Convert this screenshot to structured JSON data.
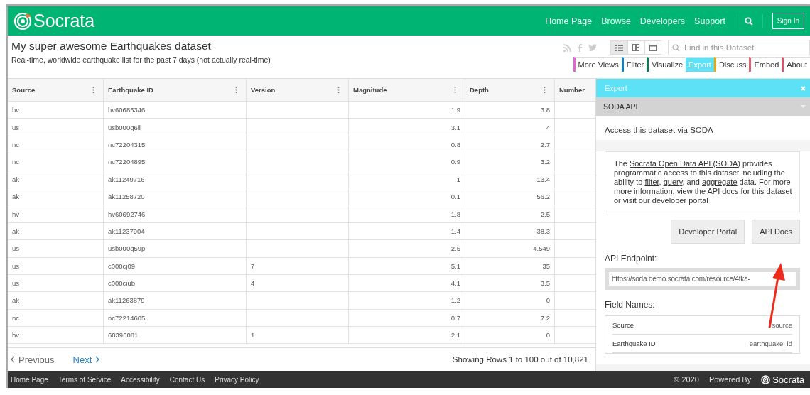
{
  "header": {
    "logo": "Socrata",
    "nav": [
      "Home Page",
      "Browse",
      "Developers",
      "Support"
    ],
    "sign_in": "Sign In"
  },
  "dataset": {
    "title": "My super awesome Earthquakes dataset",
    "description": "Real-time, worldwide earthquake list for the past 7 days (not actually real-time)"
  },
  "view_buttons": [
    {
      "selected": true
    },
    {
      "selected": false
    },
    {
      "selected": false
    }
  ],
  "search": {
    "placeholder": "Find in this Dataset"
  },
  "tabs": [
    {
      "label": "More Views",
      "color": "#e066d6",
      "selected": false
    },
    {
      "label": "Filter",
      "color": "#1a7fc1",
      "selected": false
    },
    {
      "label": "Visualize",
      "color": "#0a7a4f",
      "selected": false
    },
    {
      "label": "Export",
      "selected": true
    },
    {
      "label": "Discuss",
      "color": "#f0a500",
      "selected": false
    },
    {
      "label": "Embed",
      "color": "#e06070",
      "selected": false
    },
    {
      "label": "About",
      "color": "#d9536b",
      "selected": false
    }
  ],
  "table": {
    "columns": [
      "Source",
      "Earthquake ID",
      "Version",
      "Magnitude",
      "Depth",
      "Number"
    ],
    "rows": [
      [
        "hv",
        "hv60685346",
        "",
        "1.9",
        "3.8"
      ],
      [
        "us",
        "usb000q6il",
        "",
        "3.1",
        "4"
      ],
      [
        "nc",
        "nc72204315",
        "",
        "0.8",
        "2.7"
      ],
      [
        "nc",
        "nc72204895",
        "",
        "0.9",
        "3.2"
      ],
      [
        "ak",
        "ak11249716",
        "",
        "1",
        "13.4"
      ],
      [
        "ak",
        "ak11258720",
        "",
        "0.1",
        "56.2"
      ],
      [
        "hv",
        "hv60692746",
        "",
        "1.8",
        "2.5"
      ],
      [
        "ak",
        "ak11237904",
        "",
        "1.4",
        "38.3"
      ],
      [
        "us",
        "usb000q59p",
        "",
        "2.5",
        "4.549"
      ],
      [
        "us",
        "c000cj09",
        "7",
        "5.1",
        "35"
      ],
      [
        "us",
        "c000ciub",
        "4",
        "4.1",
        "3.5"
      ],
      [
        "ak",
        "ak11263879",
        "",
        "1.2",
        "0"
      ],
      [
        "nc",
        "nc72214605",
        "",
        "0.7",
        "7.2"
      ],
      [
        "hv",
        "60396081",
        "1",
        "2.1",
        "0"
      ]
    ]
  },
  "pagination": {
    "previous": "Previous",
    "next": "Next",
    "status": "Showing Rows 1 to 100 out of 10,821"
  },
  "export_panel": {
    "title": "Export",
    "section": "SODA API",
    "subtitle": "Access this dataset via SODA",
    "info": [
      "The ",
      "Socrata Open Data API (SODA)",
      " provides programmatic access to this dataset including the ability to ",
      "filter",
      ", ",
      "query",
      ", and ",
      "aggregate",
      " data. For more more information, view the ",
      "API docs for this dataset",
      " or visit our developer portal"
    ],
    "buttons": [
      "Developer Portal",
      "API Docs"
    ],
    "endpoint_label": "API Endpoint:",
    "endpoint": "https://soda.demo.socrata.com/resource/4tka-",
    "fields_label": "Field Names:",
    "fields": [
      {
        "name": "Source",
        "api": "source"
      },
      {
        "name": "Earthquake ID",
        "api": "earthquake_id"
      }
    ]
  },
  "footer": {
    "links": [
      "Home Page",
      "Terms of Service",
      "Accessibility",
      "Contact Us",
      "Privacy Policy"
    ],
    "copyright": "© 2020",
    "powered_by": "Powered By",
    "logo": "Socrata"
  }
}
